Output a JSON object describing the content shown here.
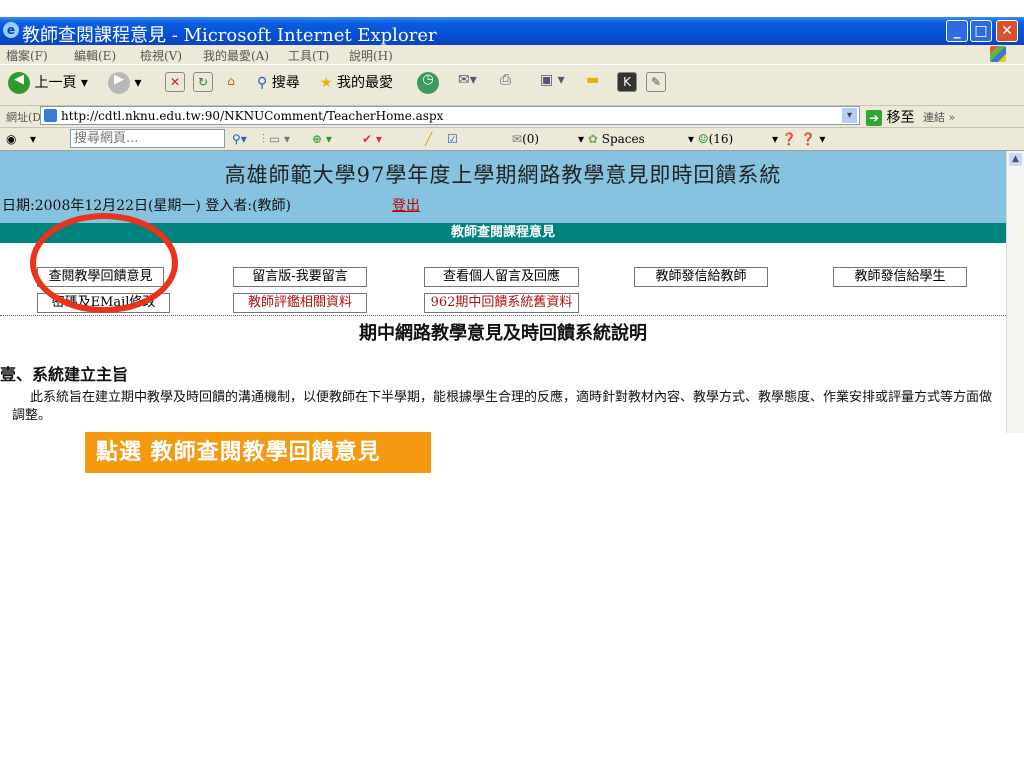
{
  "window": {
    "title": "教師查閱課程意見 - Microsoft Internet Explorer"
  },
  "menu": [
    "檔案(F)",
    "編輯(E)",
    "檢視(V)",
    "我的最愛(A)",
    "工具(T)",
    "說明(H)"
  ],
  "toolbar": {
    "back_label": "上一頁",
    "search_label": "搜尋",
    "favorites_label": "我的最愛"
  },
  "address": {
    "label": "網址(D)",
    "url": "http://cdtl.nknu.edu.tw:90/NKNUComment/TeacherHome.aspx",
    "go_label": "移至",
    "links_label": "連結"
  },
  "linksbar": {
    "search_placeholder": "搜尋網頁...",
    "mail_count": "(0)",
    "spaces_label": "Spaces",
    "buddies_count": "(16)"
  },
  "page": {
    "site_title": "高雄師範大學97學年度上學期網路教學意見即時回饋系統",
    "date_line": "日期:2008年12月22日(星期一)  登入者:(教師)",
    "logout_label": "登出",
    "section_bar": "教師查閱課程意見",
    "nav_row1": [
      "查閱教學回饋意見",
      "留言版-我要留言",
      "查看個人留言及回應",
      "教師發信給教師",
      "教師發信給學生"
    ],
    "nav_row2": [
      "密碼及EMail修改",
      "教師評鑑相關資料",
      "962期中回饋系統舊資料"
    ],
    "system_title": "期中網路教學意見及時回饋系統說明",
    "section_heading": "壹、系統建立主旨",
    "paragraph": "此系統旨在建立期中教學及時回饋的溝通機制，以便教師在下半學期，能根據學生合理的反應，適時針對教材內容、教學方式、教學態度、作業安排或評量方式等方面做調整。"
  },
  "annotation": {
    "callout_text": "點選 教師查閱教學回饋意見"
  },
  "colors": {
    "header_blue": "#87c3e0",
    "teal_bar": "#00837e",
    "callout_orange": "#f59a10",
    "ring_red": "#e8341c",
    "logout_red": "#c00000"
  }
}
